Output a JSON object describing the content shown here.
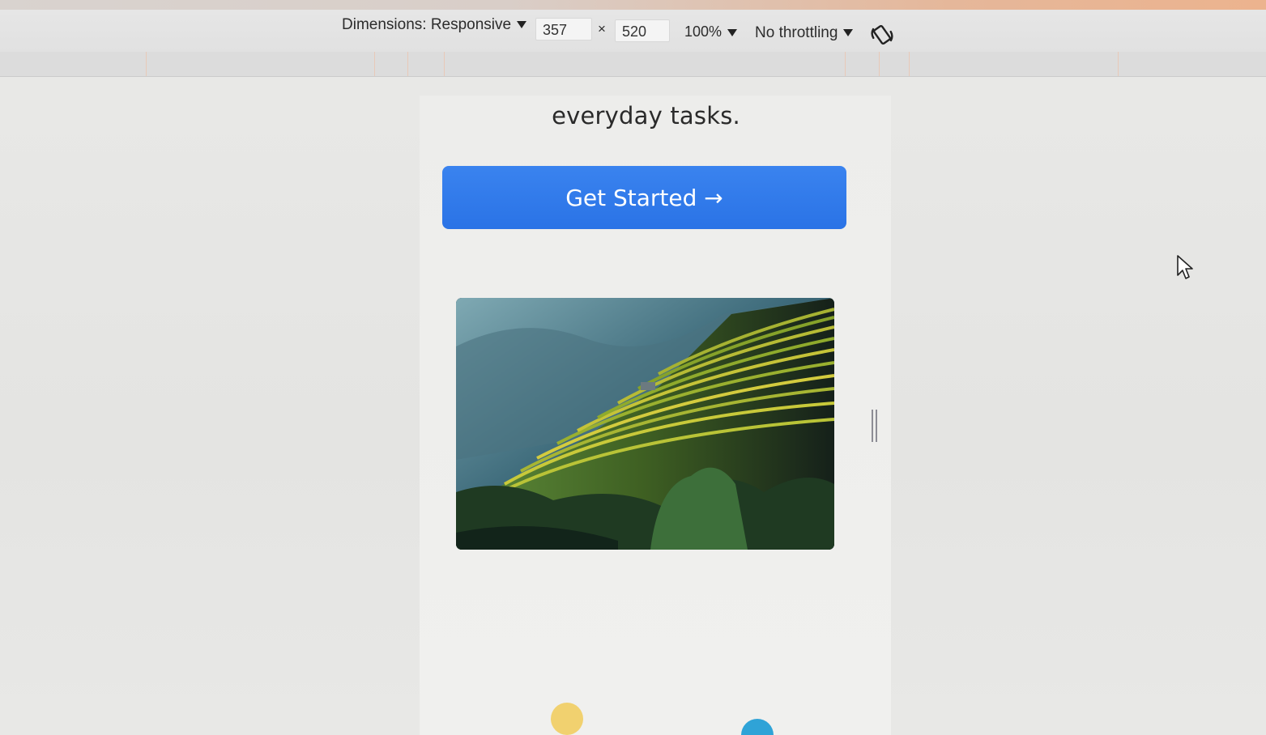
{
  "devtools": {
    "dimensions_label": "Dimensions: Responsive",
    "width_value": "357",
    "times_symbol": "×",
    "height_value": "520",
    "zoom": "100%",
    "throttling": "No throttling",
    "rotate_icon": "rotate-icon"
  },
  "page": {
    "headline": "everyday tasks.",
    "cta_label": "Get Started →",
    "hero_image": "terraced-rice-fields-photo"
  },
  "colors": {
    "cta_background": "#2f78ea",
    "cta_text": "#ffffff"
  }
}
